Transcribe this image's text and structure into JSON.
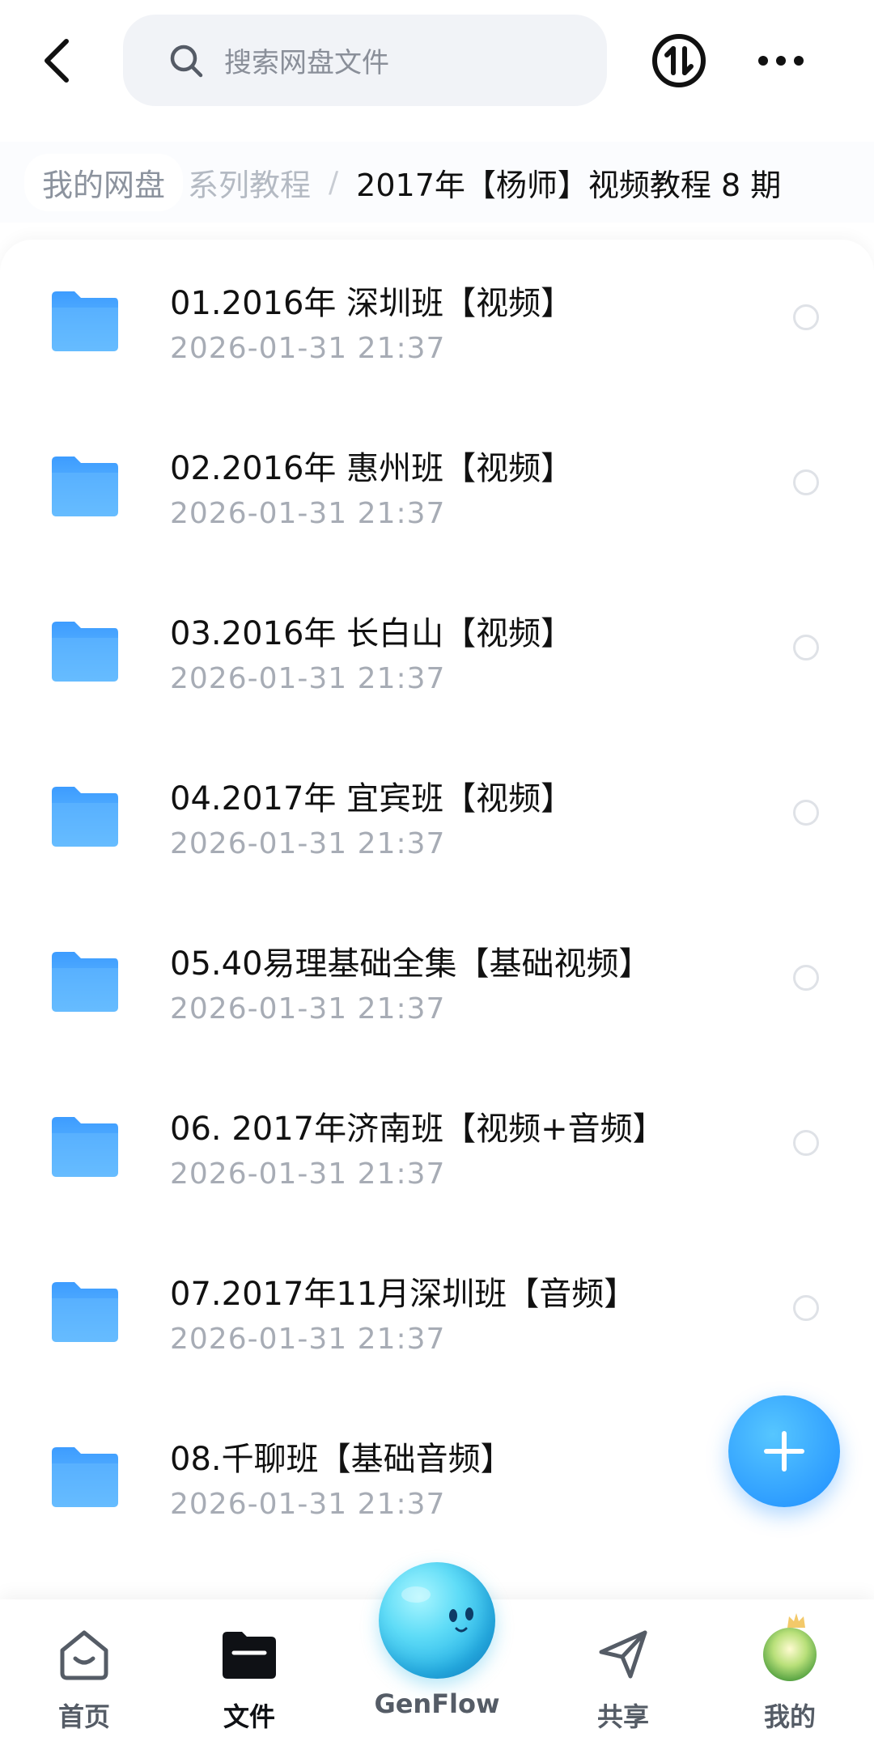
{
  "header": {
    "search_placeholder": "搜索网盘文件"
  },
  "breadcrumb": {
    "root": "我的网盘",
    "parent": "系列教程",
    "separator": "/",
    "current": "2017年【杨师】视频教程 8 期"
  },
  "files": [
    {
      "name": "01.2016年 深圳班【视频】",
      "date": "2026-01-31  21:37"
    },
    {
      "name": "02.2016年 惠州班【视频】",
      "date": "2026-01-31  21:37"
    },
    {
      "name": "03.2016年 长白山【视频】",
      "date": "2026-01-31  21:37"
    },
    {
      "name": "04.2017年 宜宾班【视频】",
      "date": "2026-01-31  21:37"
    },
    {
      "name": "05.40易理基础全集【基础视频】",
      "date": "2026-01-31  21:37"
    },
    {
      "name": "06. 2017年济南班【视频+音频】",
      "date": "2026-01-31  21:37"
    },
    {
      "name": "07.2017年11月深圳班【音频】",
      "date": "2026-01-31  21:37"
    },
    {
      "name": "08.千聊班【基础音频】",
      "date": "2026-01-31  21:37"
    }
  ],
  "nav": {
    "home": "首页",
    "files": "文件",
    "genflow": "GenFlow",
    "share": "共享",
    "mine": "我的"
  },
  "colors": {
    "accent": "#1e8dff",
    "folder": "#4aa8ff",
    "date_text": "#a7acb5"
  },
  "icons": {
    "back": "chevron-left-icon",
    "search": "search-icon",
    "transfer": "transfer-icon",
    "more": "more-icon",
    "folder": "folder-icon",
    "add": "plus-icon",
    "home": "home-icon",
    "files": "folder-nav-icon",
    "share": "send-icon"
  }
}
